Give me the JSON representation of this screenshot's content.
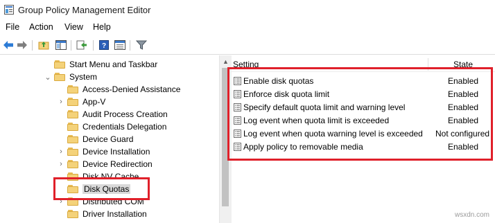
{
  "window": {
    "title": "Group Policy Management Editor"
  },
  "menu": [
    "File",
    "Action",
    "View",
    "Help"
  ],
  "toolbar": {
    "icons": [
      "back-arrow-icon",
      "forward-arrow-icon",
      "up-folder-icon",
      "show-hide-tree-icon",
      "export-list-icon",
      "help-icon",
      "properties-view-icon",
      "filter-icon"
    ]
  },
  "tree": {
    "items": [
      {
        "label": "Start Menu and Taskbar"
      },
      {
        "label": "System"
      },
      {
        "label": "Access-Denied Assistance"
      },
      {
        "label": "App-V"
      },
      {
        "label": "Audit Process Creation"
      },
      {
        "label": "Credentials Delegation"
      },
      {
        "label": "Device Guard"
      },
      {
        "label": "Device Installation"
      },
      {
        "label": "Device Redirection"
      },
      {
        "label": "Disk NV Cache"
      },
      {
        "label": "Disk Quotas"
      },
      {
        "label": "Distributed COM"
      },
      {
        "label": "Driver Installation"
      }
    ]
  },
  "list": {
    "col_setting": "Setting",
    "col_state": "State",
    "rows": [
      {
        "setting": "Enable disk quotas",
        "state": "Enabled"
      },
      {
        "setting": "Enforce disk quota limit",
        "state": "Enabled"
      },
      {
        "setting": "Specify default quota limit and warning level",
        "state": "Enabled"
      },
      {
        "setting": "Log event when quota limit is exceeded",
        "state": "Enabled"
      },
      {
        "setting": "Log event when quota warning level is exceeded",
        "state": "Not configured"
      },
      {
        "setting": "Apply policy to removable media",
        "state": "Enabled"
      }
    ]
  },
  "highlight_color": "#e0202a",
  "watermark": "wsxdn.com"
}
